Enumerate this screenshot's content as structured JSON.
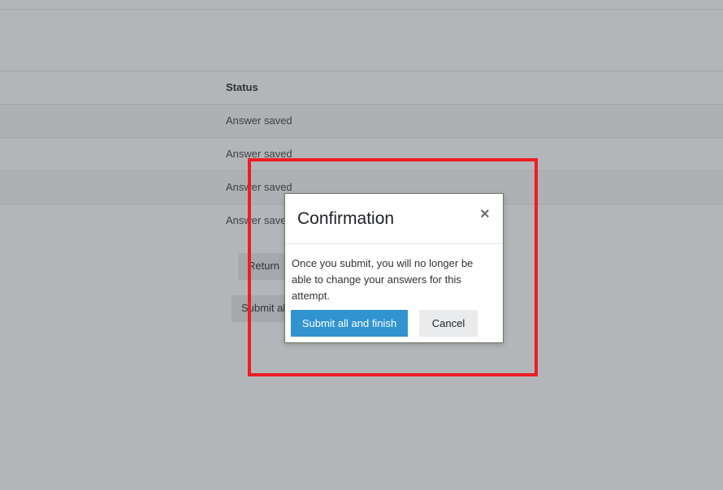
{
  "table": {
    "header": "Status",
    "rows": [
      "Answer saved",
      "Answer saved",
      "Answer saved",
      "Answer saved"
    ]
  },
  "page_buttons": {
    "return_label": "Return",
    "submit_all_label": "Submit all and finish"
  },
  "modal": {
    "title": "Confirmation",
    "close_glyph": "×",
    "body": "Once you submit, you will no longer be able to change your answers for this attempt.",
    "primary_label": "Submit all and finish",
    "secondary_label": "Cancel"
  },
  "colors": {
    "primary": "#3094d1",
    "highlight": "#ee1c24"
  }
}
